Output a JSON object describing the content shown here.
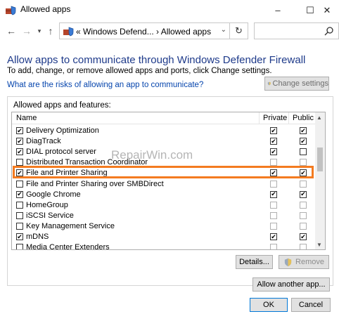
{
  "window": {
    "title": "Allowed apps"
  },
  "nav": {
    "address": "«  Windows Defend...  ›  Allowed apps",
    "search_placeholder": ""
  },
  "main": {
    "heading": "Allow apps to communicate through Windows Defender Firewall",
    "subtitle": "To add, change, or remove allowed apps and ports, click Change settings.",
    "risk_link": "What are the risks of allowing an app to communicate?",
    "change_settings": "Change settings",
    "group_label": "Allowed apps and features:",
    "columns": {
      "name": "Name",
      "private": "Private",
      "public": "Public"
    },
    "rows": [
      {
        "name": "Delivery Optimization",
        "enabled": true,
        "private": true,
        "public": true
      },
      {
        "name": "DiagTrack",
        "enabled": true,
        "private": true,
        "public": true
      },
      {
        "name": "DIAL protocol server",
        "enabled": true,
        "private": true,
        "public": false
      },
      {
        "name": "Distributed Transaction Coordinator",
        "enabled": false,
        "private": false,
        "public": false
      },
      {
        "name": "File and Printer Sharing",
        "enabled": true,
        "private": true,
        "public": true
      },
      {
        "name": "File and Printer Sharing over SMBDirect",
        "enabled": false,
        "private": false,
        "public": false
      },
      {
        "name": "Google Chrome",
        "enabled": true,
        "private": true,
        "public": true
      },
      {
        "name": "HomeGroup",
        "enabled": false,
        "private": false,
        "public": false
      },
      {
        "name": "iSCSI Service",
        "enabled": false,
        "private": false,
        "public": false
      },
      {
        "name": "Key Management Service",
        "enabled": false,
        "private": false,
        "public": false
      },
      {
        "name": "mDNS",
        "enabled": true,
        "private": true,
        "public": true
      },
      {
        "name": "Media Center Extenders",
        "enabled": false,
        "private": false,
        "public": false
      }
    ],
    "details": "Details...",
    "remove": "Remove",
    "allow_another": "Allow another app...",
    "ok": "OK",
    "cancel": "Cancel"
  },
  "watermark": "RepairWin.com",
  "colors": {
    "heading": "#1e3a8a",
    "link": "#0645ad",
    "highlight": "#f47b20"
  }
}
